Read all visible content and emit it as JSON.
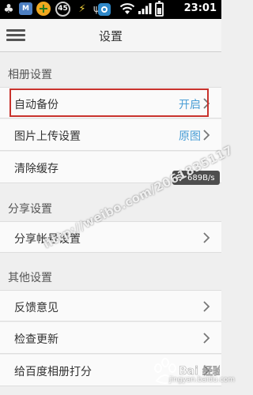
{
  "status_bar": {
    "badge_number": "45",
    "chat_icon_text": "M",
    "time": "23:01"
  },
  "header": {
    "title": "设置"
  },
  "sections": [
    {
      "title": "相册设置",
      "items": [
        {
          "label": "自动备份",
          "value": "开启"
        },
        {
          "label": "图片上传设置",
          "value": "原图"
        },
        {
          "label": "清除缓存",
          "value": ""
        }
      ]
    },
    {
      "title": "分享设置",
      "items": [
        {
          "label": "分享帐号设置",
          "value": ""
        }
      ]
    },
    {
      "title": "其他设置",
      "items": [
        {
          "label": "反馈意见",
          "value": ""
        },
        {
          "label": "检查更新",
          "value": ""
        },
        {
          "label": "给百度相册打分",
          "value": ""
        }
      ]
    }
  ],
  "network_speed": "689B/s",
  "watermark": "http://weibo.com/2061835117",
  "logo_text": "jingyan.baidu.com",
  "colors": {
    "accent": "#4a9ed6",
    "highlight": "#c8322c"
  }
}
